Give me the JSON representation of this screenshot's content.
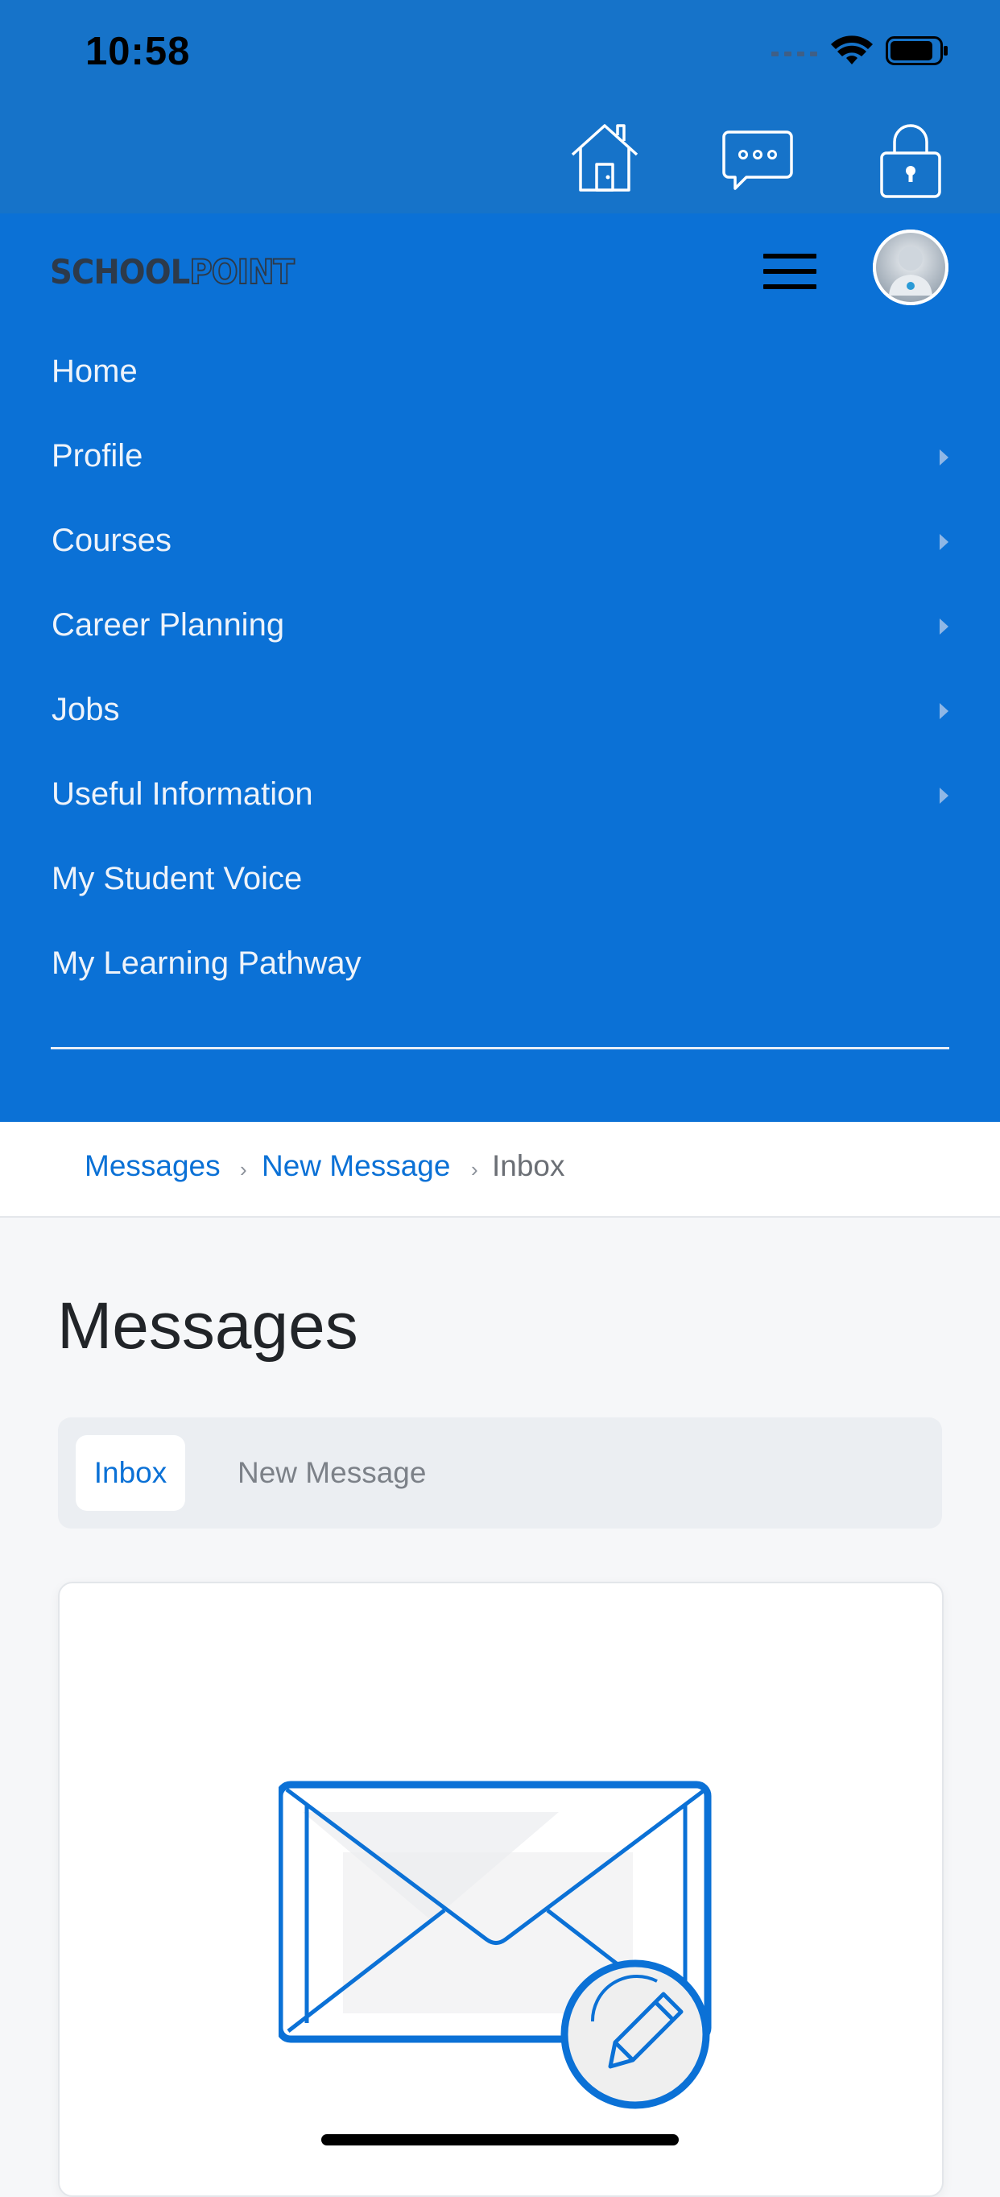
{
  "status": {
    "time": "10:58"
  },
  "topbar": {
    "icons": [
      "home-icon",
      "chat-icon",
      "lock-icon"
    ]
  },
  "nav": {
    "logo_part1": "SCHOOL",
    "logo_part2": "POINT",
    "items": [
      {
        "label": "Home",
        "has_submenu": false
      },
      {
        "label": "Profile",
        "has_submenu": true
      },
      {
        "label": "Courses",
        "has_submenu": true
      },
      {
        "label": "Career Planning",
        "has_submenu": true
      },
      {
        "label": "Jobs",
        "has_submenu": true
      },
      {
        "label": "Useful Information",
        "has_submenu": true
      },
      {
        "label": "My Student Voice",
        "has_submenu": false
      },
      {
        "label": "My Learning Pathway",
        "has_submenu": false
      }
    ]
  },
  "breadcrumb": {
    "items": [
      "Messages",
      "New Message",
      "Inbox"
    ],
    "separator": "›"
  },
  "main": {
    "title": "Messages",
    "tabs": [
      {
        "label": "Inbox",
        "active": true
      },
      {
        "label": "New Message",
        "active": false
      }
    ]
  },
  "colors": {
    "primary": "#0b71d6",
    "topbar": "#1673c9",
    "page_bg": "#f6f7f9"
  }
}
